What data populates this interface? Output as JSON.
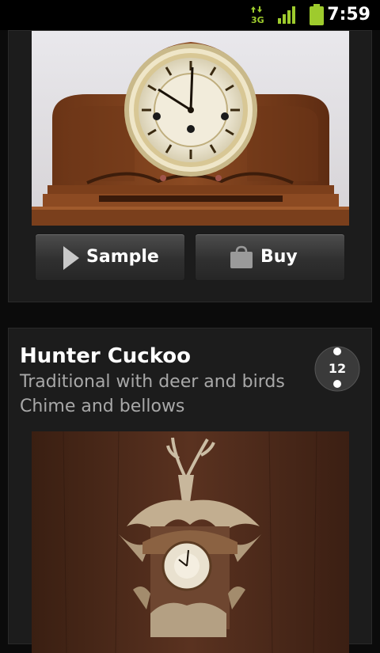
{
  "status_bar": {
    "network": "3G",
    "time": "7:59"
  },
  "items": [
    {
      "image": "mantel-clock-image",
      "buttons": [
        {
          "label": "Sample",
          "icon": "play-icon"
        },
        {
          "label": "Buy",
          "icon": "shopping-bag-icon"
        }
      ]
    },
    {
      "title": "Hunter Cuckoo",
      "lines": [
        "Traditional with deer and birds",
        "Chime and bellows"
      ],
      "badge": "12",
      "image": "cuckoo-clock-image"
    }
  ],
  "colors": {
    "background": "#0b0b0b",
    "card": "#1c1c1c",
    "secondary_text": "#a8a8a8",
    "battery": "#9ecb2d"
  }
}
